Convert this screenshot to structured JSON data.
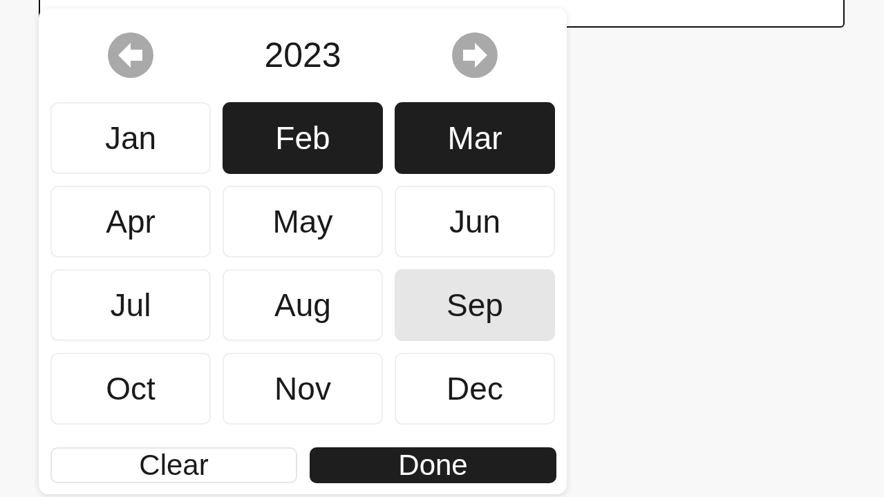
{
  "year_nav": {
    "year": "2023"
  },
  "months": [
    {
      "label": "Jan",
      "selected": false,
      "highlighted": false
    },
    {
      "label": "Feb",
      "selected": true,
      "highlighted": false
    },
    {
      "label": "Mar",
      "selected": true,
      "highlighted": false
    },
    {
      "label": "Apr",
      "selected": false,
      "highlighted": false
    },
    {
      "label": "May",
      "selected": false,
      "highlighted": false
    },
    {
      "label": "Jun",
      "selected": false,
      "highlighted": false
    },
    {
      "label": "Jul",
      "selected": false,
      "highlighted": false
    },
    {
      "label": "Aug",
      "selected": false,
      "highlighted": false
    },
    {
      "label": "Sep",
      "selected": false,
      "highlighted": true
    },
    {
      "label": "Oct",
      "selected": false,
      "highlighted": false
    },
    {
      "label": "Nov",
      "selected": false,
      "highlighted": false
    },
    {
      "label": "Dec",
      "selected": false,
      "highlighted": false
    }
  ],
  "actions": [
    {
      "label": "Clear",
      "kind": "secondary"
    },
    {
      "label": "Done",
      "kind": "primary"
    }
  ]
}
